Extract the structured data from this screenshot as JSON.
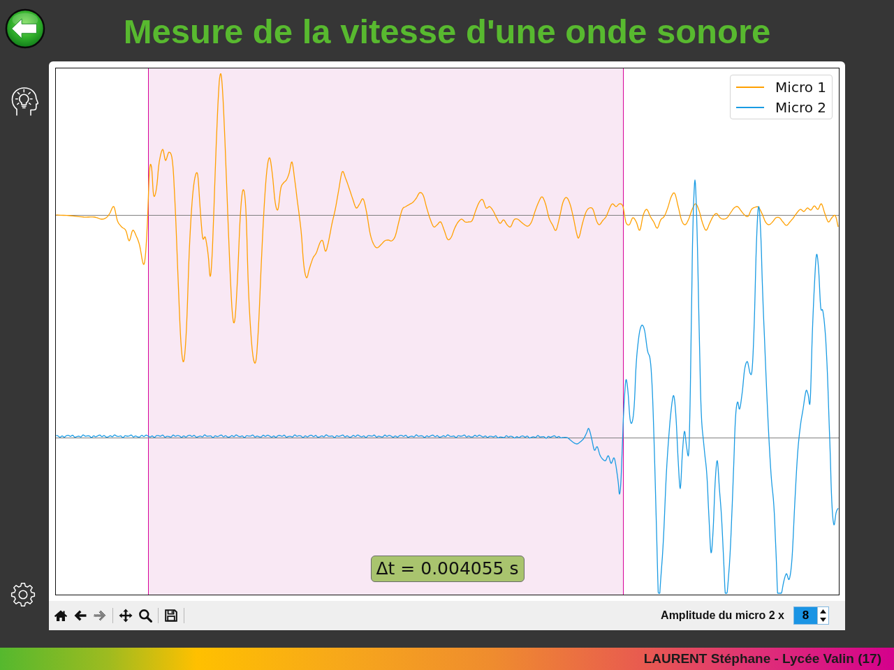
{
  "header": {
    "title": "Mesure de la vitesse d'une onde sonore"
  },
  "plot": {
    "legend": [
      {
        "label": "Micro 1",
        "color": "#ffa000"
      },
      {
        "label": "Micro 2",
        "color": "#1a9be3"
      }
    ],
    "measurement": "Δt = 0.004055 s"
  },
  "toolbar": {
    "groups": [
      {
        "tools": [
          {
            "kind": "home",
            "disabled": false
          },
          {
            "kind": "back",
            "disabled": false
          },
          {
            "kind": "forward",
            "disabled": true
          }
        ]
      },
      {
        "tools": [
          {
            "kind": "pan",
            "disabled": false
          },
          {
            "kind": "zoom",
            "disabled": false
          }
        ]
      },
      {
        "tools": [
          {
            "kind": "save",
            "disabled": false
          }
        ]
      }
    ],
    "amplitude": {
      "label": "Amplitude du micro 2 x",
      "value": "8"
    }
  },
  "footer": {
    "credit": "LAURENT Stéphane - Lycée Valin (17)"
  }
}
